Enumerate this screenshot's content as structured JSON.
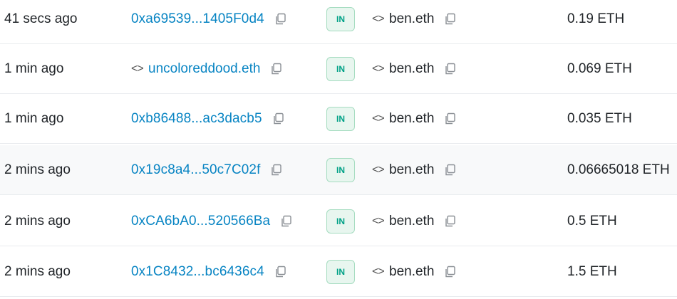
{
  "transactions": [
    {
      "age": "41 secs ago",
      "from": "0xa69539...1405F0d4",
      "from_is_ens": false,
      "direction": "IN",
      "to": "ben.eth",
      "value": "0.19 ETH"
    },
    {
      "age": "1 min ago",
      "from": "uncoloreddood.eth",
      "from_is_ens": true,
      "direction": "IN",
      "to": "ben.eth",
      "value": "0.069 ETH"
    },
    {
      "age": "1 min ago",
      "from": "0xb86488...ac3dacb5",
      "from_is_ens": false,
      "direction": "IN",
      "to": "ben.eth",
      "value": "0.035 ETH"
    },
    {
      "age": "2 mins ago",
      "from": "0x19c8a4...50c7C02f",
      "from_is_ens": false,
      "direction": "IN",
      "to": "ben.eth",
      "value": "0.06665018 ETH"
    },
    {
      "age": "2 mins ago",
      "from": "0xCA6bA0...520566Ba",
      "from_is_ens": false,
      "direction": "IN",
      "to": "ben.eth",
      "value": "0.5 ETH"
    },
    {
      "age": "2 mins ago",
      "from": "0x1C8432...bc6436c4",
      "from_is_ens": false,
      "direction": "IN",
      "to": "ben.eth",
      "value": "1.5 ETH"
    }
  ],
  "icons": {
    "copy": "copy-icon",
    "contract": "code-icon"
  },
  "colors": {
    "link": "#0784c3",
    "badge_text": "#00a186",
    "badge_bg": "#e8f6ef",
    "badge_border": "#a5dcc0",
    "alt_row": "#f8f9fa"
  }
}
